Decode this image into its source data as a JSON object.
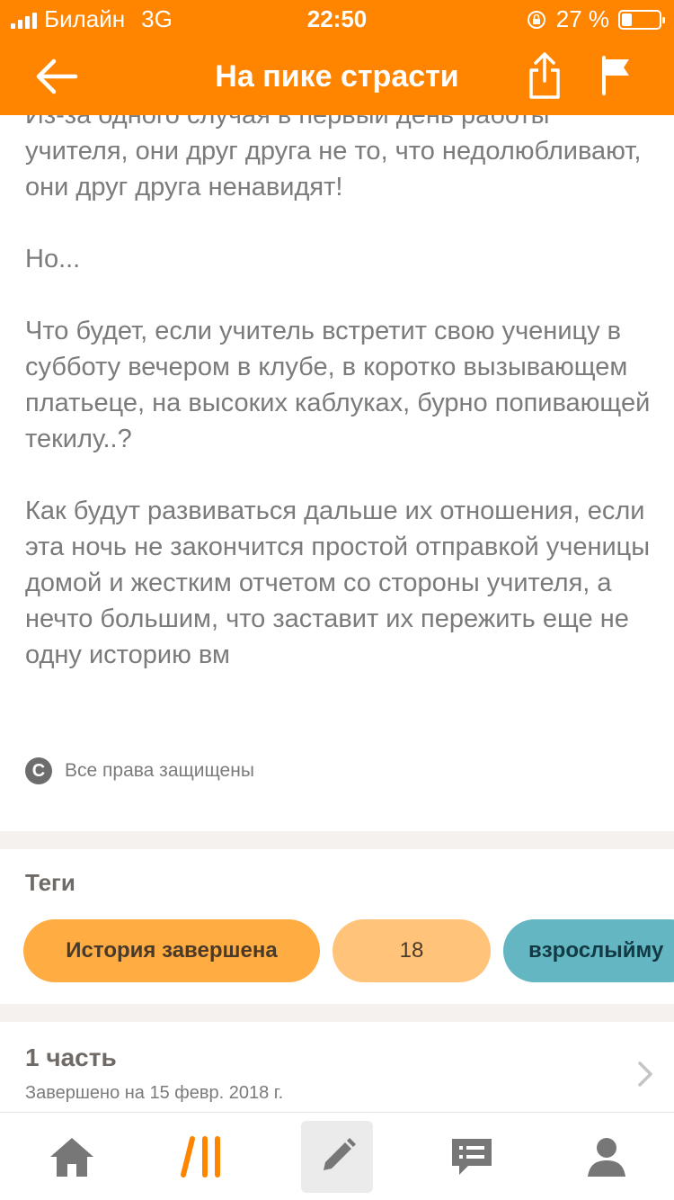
{
  "status_bar": {
    "carrier": "Билайн",
    "network": "3G",
    "time": "22:50",
    "battery_percent": "27 %",
    "battery_level": 0.27
  },
  "header": {
    "title": "На пике страсти",
    "back_icon": "arrow-left-icon",
    "share_icon": "share-icon",
    "flag_icon": "flag-icon"
  },
  "description": {
    "paragraphs": [
      "Из-за одного случая в первый день работы учителя, они друг друга не то, что недолюбливают, они друг друга ненавидят!",
      "Но...",
      "Что будет, если учитель встретит свою ученицу в субботу вечером в клубе, в коротко вызывающем платьеце, на высоких каблуках, бурно попивающей текилу..?",
      "Как будут развиваться дальше их отношения, если эта ночь не закончится простой отправкой ученицы домой и жестким отчетом со стороны учителя, а нечто большим, что заставит их пережить еще не одну историю вм"
    ],
    "copyright": "Все права защищены"
  },
  "tags": {
    "title": "Теги",
    "items": [
      "История завершена",
      "18",
      "взрослыйму"
    ]
  },
  "parts": {
    "title": "1 часть",
    "subtitle": "Завершено на 15 февр. 2018 г."
  },
  "colors": {
    "accent": "#ff8500",
    "tag_primary": "#ffad42",
    "tag_secondary": "#ffc47a",
    "tag_teal": "#64b6c2"
  },
  "bottom_nav": {
    "items": [
      "home-icon",
      "library-icon",
      "write-icon",
      "messages-icon",
      "profile-icon"
    ]
  }
}
